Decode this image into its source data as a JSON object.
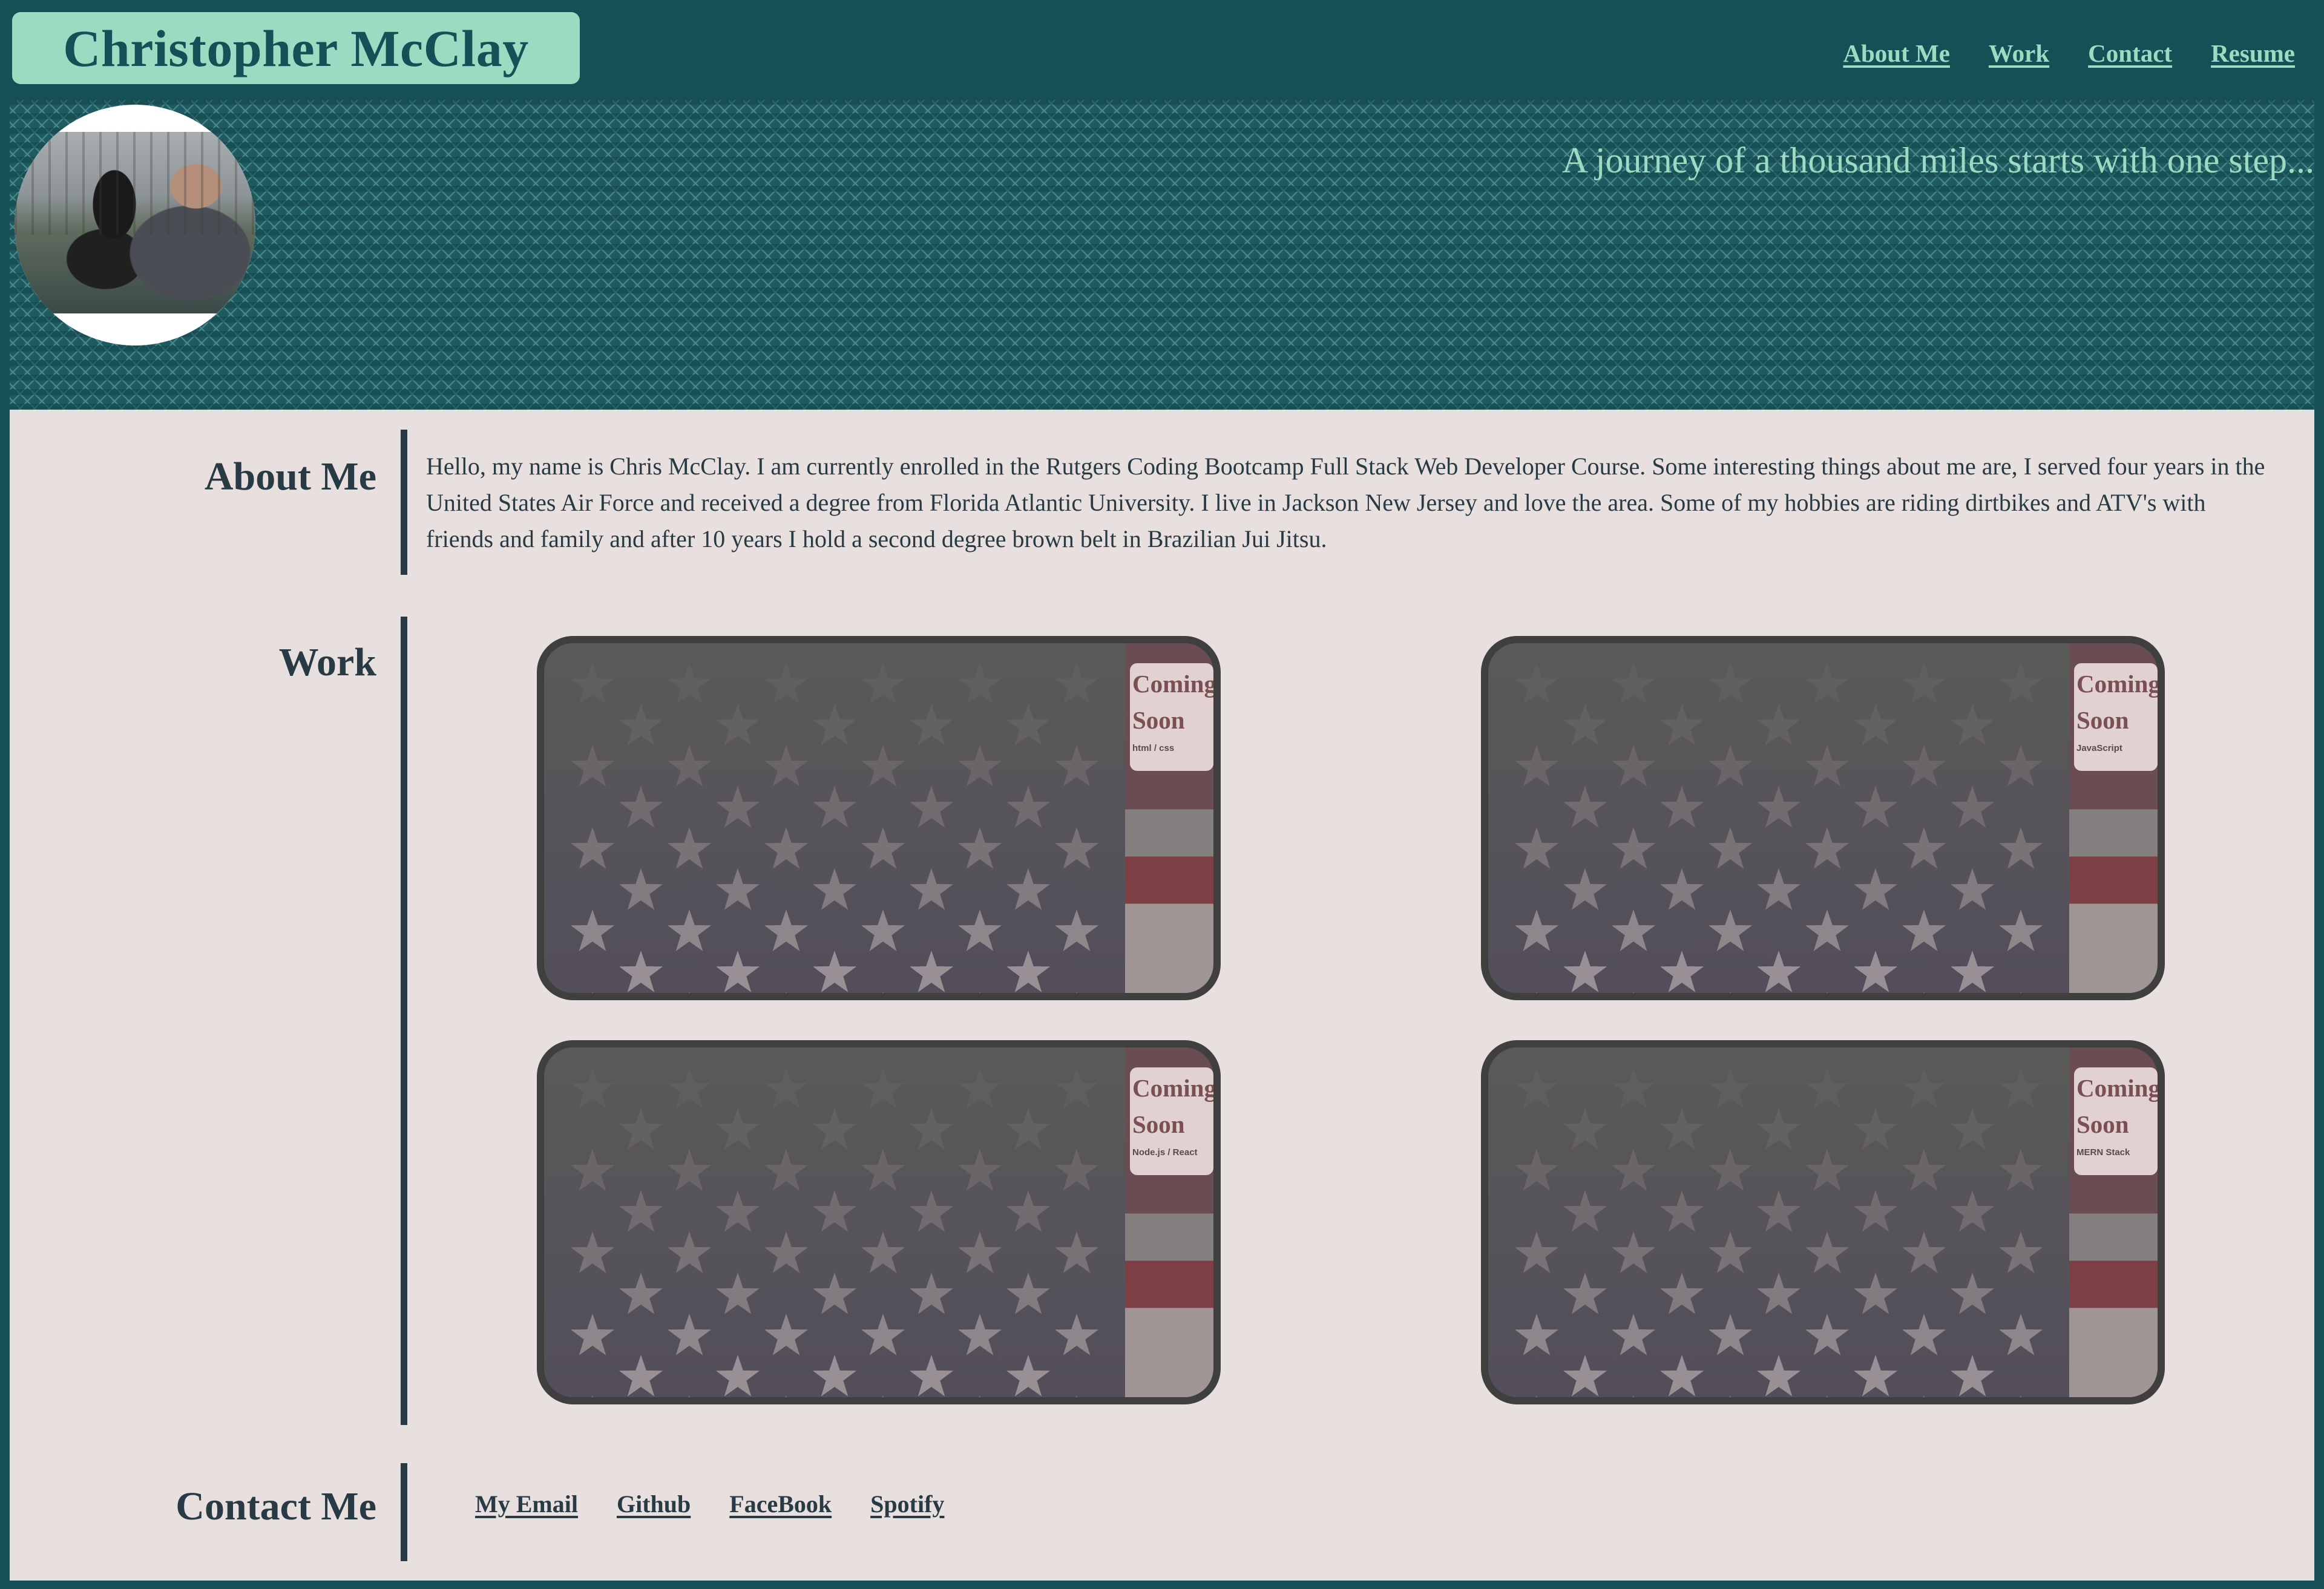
{
  "header": {
    "name": "Christopher McClay",
    "nav": [
      "About Me",
      "Work",
      "Contact",
      "Resume"
    ]
  },
  "hero": {
    "tagline": "A journey of a thousand miles starts with one step...",
    "avatar_alt": "avatar"
  },
  "about": {
    "title": "About Me",
    "text": "Hello, my name is Chris McClay. I am currently enrolled in the Rutgers Coding Bootcamp Full Stack Web Developer Course. Some interesting things about me are, I served four years in the United States Air Force and received a degree from Florida Atlantic University. I live in Jackson New Jersey and love the area. Some of my hobbies are riding dirtbikes and ATV's with friends and family and after 10 years I hold a second degree brown belt in Brazilian Jui Jitsu."
  },
  "work": {
    "title": "Work",
    "cards": [
      {
        "status": "Coming Soon",
        "tech": "html / css"
      },
      {
        "status": "Coming Soon",
        "tech": "JavaScript"
      },
      {
        "status": "Coming Soon",
        "tech": "Node.js / React"
      },
      {
        "status": "Coming Soon",
        "tech": "MERN Stack"
      }
    ]
  },
  "contact": {
    "title": "Contact Me",
    "links": [
      "My Email",
      "Github",
      "FaceBook",
      "Spotify"
    ]
  },
  "colors": {
    "header_bg": "#164f55",
    "accent": "#9ddac2",
    "main_bg": "#e8dfdf",
    "text": "#283a43"
  }
}
